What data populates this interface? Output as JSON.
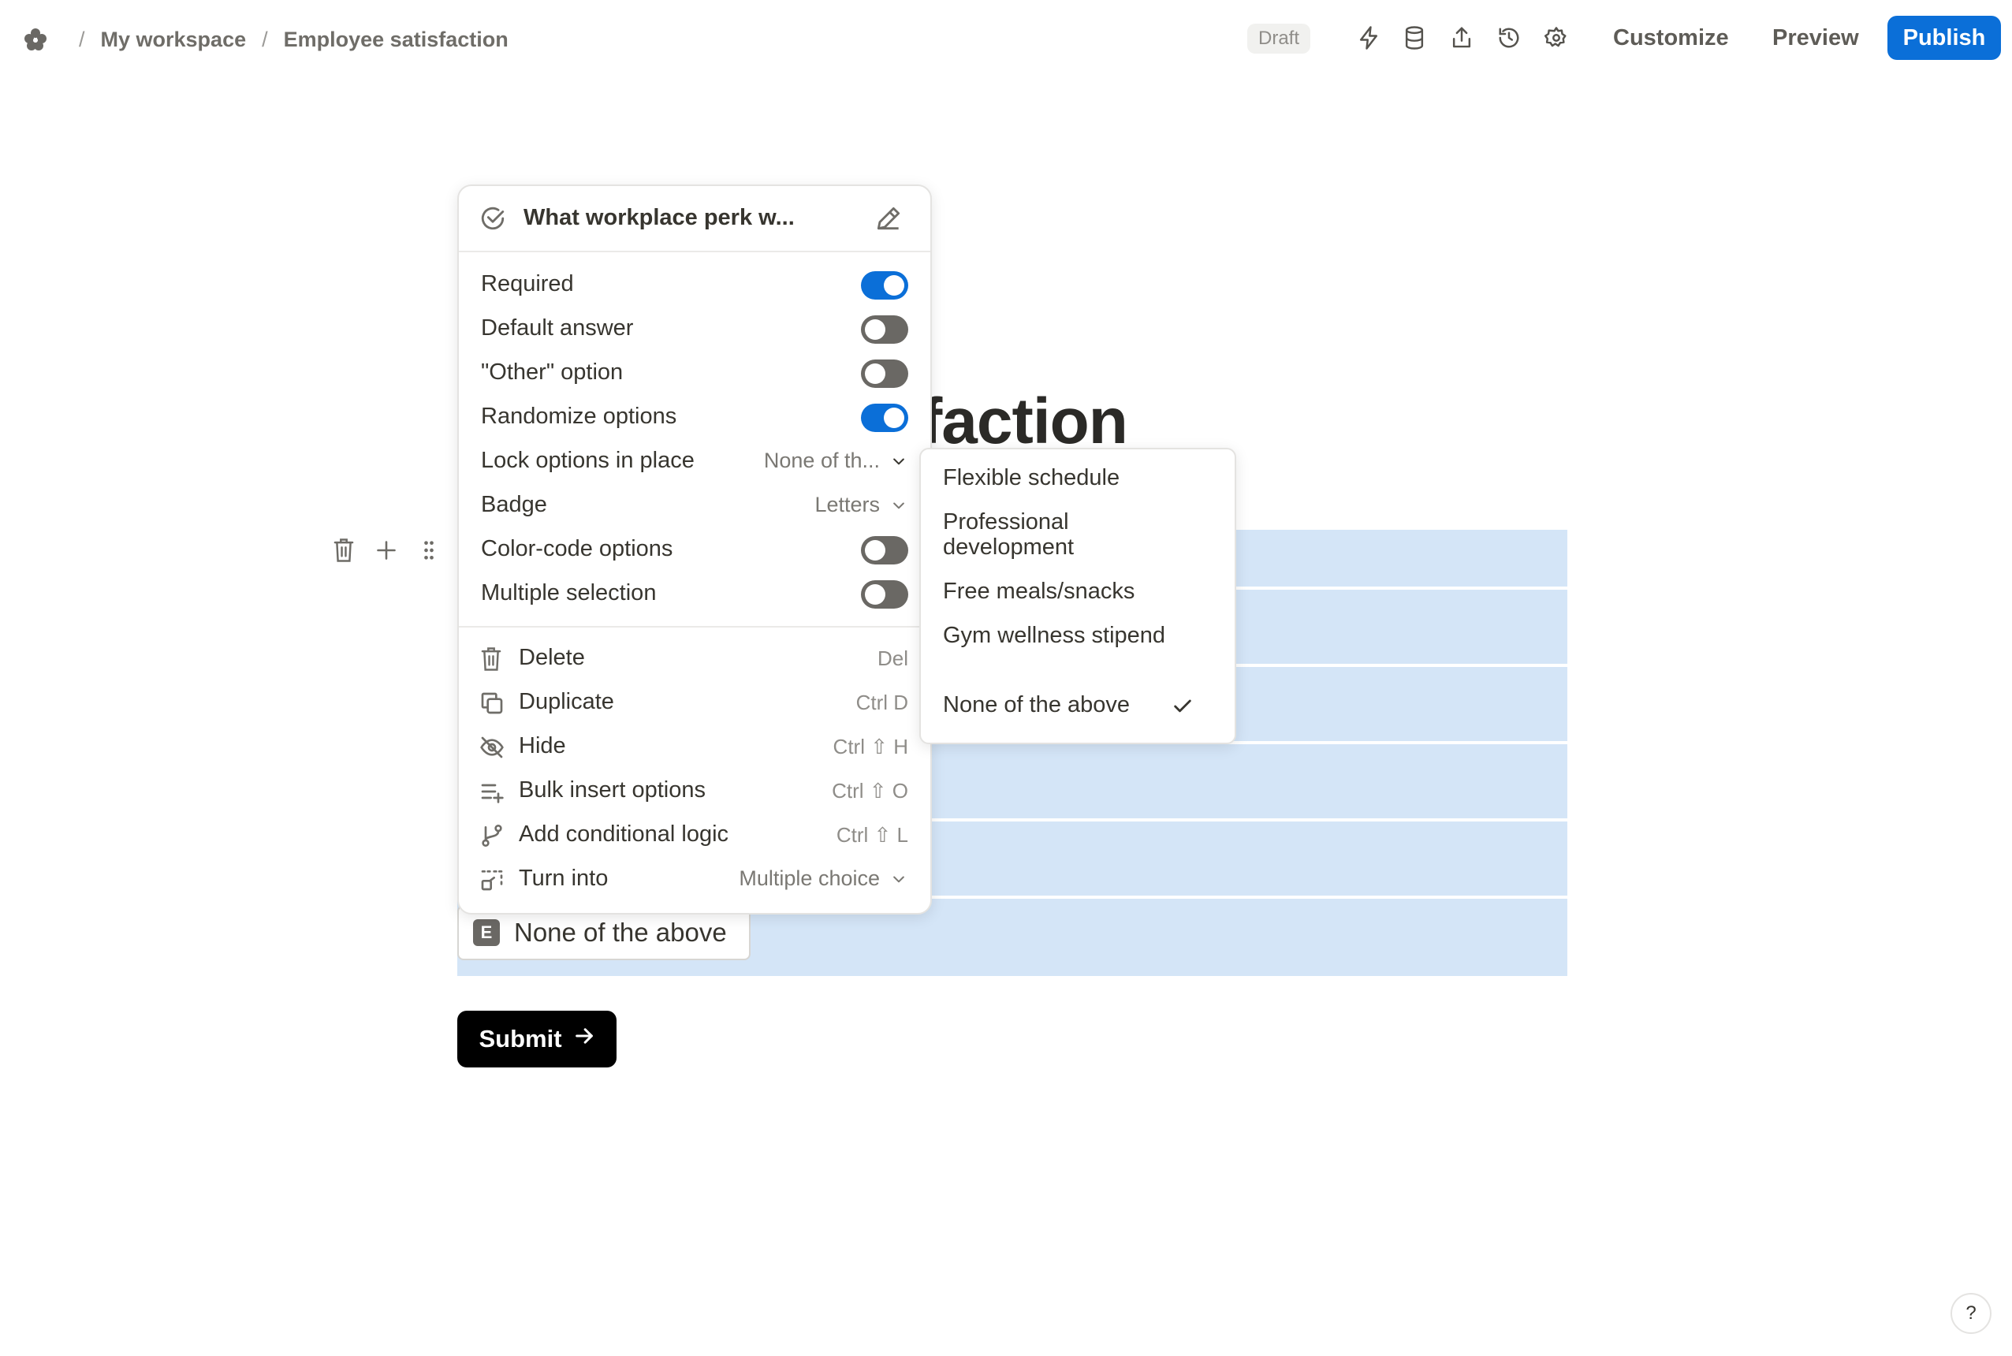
{
  "breadcrumb": {
    "workspace": "My workspace",
    "form": "Employee satisfaction",
    "separator": "/"
  },
  "header": {
    "status": "Draft",
    "customize": "Customize",
    "preview": "Preview",
    "publish": "Publish"
  },
  "form": {
    "title_visible": "faction",
    "last_option": {
      "badge": "E",
      "label": "None of the above"
    },
    "submit_label": "Submit"
  },
  "menu": {
    "question": "What workplace perk w...",
    "toggles": [
      {
        "label": "Required",
        "on": true
      },
      {
        "label": "Default answer",
        "on": false
      },
      {
        "label": "\"Other\" option",
        "on": false
      },
      {
        "label": "Randomize options",
        "on": true
      }
    ],
    "lock": {
      "label": "Lock options in place",
      "value": "None of th..."
    },
    "badge": {
      "label": "Badge",
      "value": "Letters"
    },
    "toggles2": [
      {
        "label": "Color-code options",
        "on": false
      },
      {
        "label": "Multiple selection",
        "on": false
      }
    ],
    "actions": [
      {
        "label": "Delete",
        "shortcut": "Del",
        "icon": "trash-icon"
      },
      {
        "label": "Duplicate",
        "shortcut": "Ctrl D",
        "icon": "copy-icon"
      },
      {
        "label": "Hide",
        "shortcut": "Ctrl ⇧ H",
        "icon": "eye-off-icon"
      },
      {
        "label": "Bulk insert options",
        "shortcut": "Ctrl ⇧ O",
        "icon": "list-plus-icon"
      },
      {
        "label": "Add conditional logic",
        "shortcut": "Ctrl ⇧ L",
        "icon": "branch-icon"
      }
    ],
    "turn_into": {
      "label": "Turn into",
      "value": "Multiple choice"
    }
  },
  "submenu": {
    "options": [
      {
        "label": "Flexible schedule",
        "checked": false
      },
      {
        "label": "Professional development",
        "checked": false
      },
      {
        "label": "Free meals/snacks",
        "checked": false
      },
      {
        "label": "Gym wellness stipend",
        "checked": false
      },
      {
        "label": "None of the above",
        "checked": true
      }
    ]
  },
  "help": "?",
  "colors": {
    "accent": "#0b6fd8",
    "option_highlight": "#d4e5f7",
    "toggle_off": "#6a6864"
  }
}
